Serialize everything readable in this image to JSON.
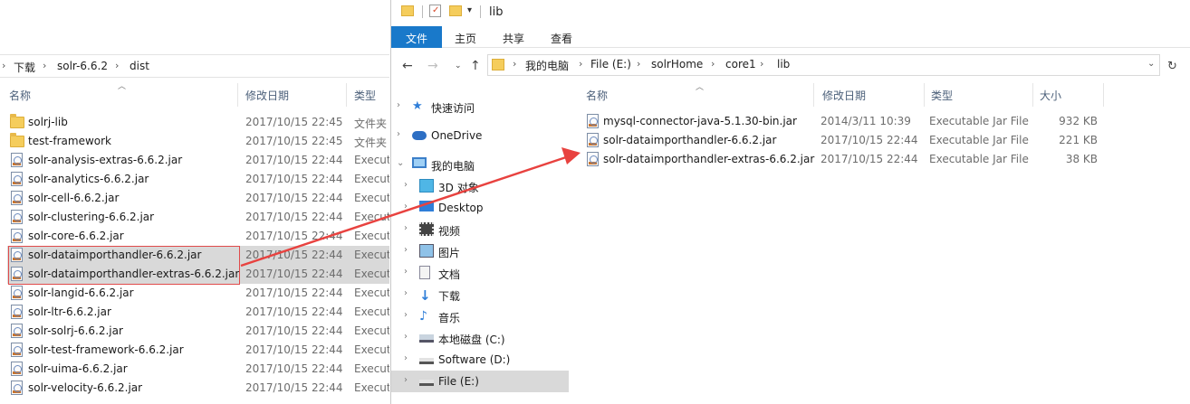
{
  "left_window": {
    "breadcrumb": [
      "下载",
      "solr-6.6.2",
      "dist"
    ],
    "columns": {
      "name": "名称",
      "date": "修改日期",
      "type": "类型"
    },
    "files": [
      {
        "name": "solrj-lib",
        "date": "2017/10/15 22:45",
        "type": "文件夹",
        "icon": "folder-icon"
      },
      {
        "name": "test-framework",
        "date": "2017/10/15 22:45",
        "type": "文件夹",
        "icon": "folder-icon"
      },
      {
        "name": "solr-analysis-extras-6.6.2.jar",
        "date": "2017/10/15 22:44",
        "type": "Executa",
        "icon": "jar-icon"
      },
      {
        "name": "solr-analytics-6.6.2.jar",
        "date": "2017/10/15 22:44",
        "type": "Executa",
        "icon": "jar-icon"
      },
      {
        "name": "solr-cell-6.6.2.jar",
        "date": "2017/10/15 22:44",
        "type": "Executa",
        "icon": "jar-icon"
      },
      {
        "name": "solr-clustering-6.6.2.jar",
        "date": "2017/10/15 22:44",
        "type": "Executa",
        "icon": "jar-icon"
      },
      {
        "name": "solr-core-6.6.2.jar",
        "date": "2017/10/15 22:44",
        "type": "Executa",
        "icon": "jar-icon"
      },
      {
        "name": "solr-dataimporthandler-6.6.2.jar",
        "date": "2017/10/15 22:44",
        "type": "Executa",
        "icon": "jar-icon",
        "selected": true
      },
      {
        "name": "solr-dataimporthandler-extras-6.6.2.jar",
        "date": "2017/10/15 22:44",
        "type": "Executa",
        "icon": "jar-icon",
        "selected": true
      },
      {
        "name": "solr-langid-6.6.2.jar",
        "date": "2017/10/15 22:44",
        "type": "Executa",
        "icon": "jar-icon"
      },
      {
        "name": "solr-ltr-6.6.2.jar",
        "date": "2017/10/15 22:44",
        "type": "Executa",
        "icon": "jar-icon"
      },
      {
        "name": "solr-solrj-6.6.2.jar",
        "date": "2017/10/15 22:44",
        "type": "Executa",
        "icon": "jar-icon"
      },
      {
        "name": "solr-test-framework-6.6.2.jar",
        "date": "2017/10/15 22:44",
        "type": "Executa",
        "icon": "jar-icon"
      },
      {
        "name": "solr-uima-6.6.2.jar",
        "date": "2017/10/15 22:44",
        "type": "Executa",
        "icon": "jar-icon"
      },
      {
        "name": "solr-velocity-6.6.2.jar",
        "date": "2017/10/15 22:44",
        "type": "Executa",
        "icon": "jar-icon"
      }
    ]
  },
  "right_window": {
    "title": "lib",
    "ribbon_tabs": [
      "文件",
      "主页",
      "共享",
      "查看"
    ],
    "breadcrumb": [
      "我的电脑",
      "File (E:)",
      "solrHome",
      "core1",
      "lib"
    ],
    "columns": {
      "name": "名称",
      "date": "修改日期",
      "type": "类型",
      "size": "大小"
    },
    "nav": [
      {
        "label": "快速访问",
        "icon": "star-icon"
      },
      {
        "label": "OneDrive",
        "icon": "cloud-icon"
      },
      {
        "label": "我的电脑",
        "icon": "computer-icon"
      },
      {
        "label": "3D 对象",
        "icon": "cube-icon"
      },
      {
        "label": "Desktop",
        "icon": "desktop-icon"
      },
      {
        "label": "视频",
        "icon": "video-icon"
      },
      {
        "label": "图片",
        "icon": "picture-icon"
      },
      {
        "label": "文档",
        "icon": "document-icon"
      },
      {
        "label": "下载",
        "icon": "download-icon"
      },
      {
        "label": "音乐",
        "icon": "music-icon"
      },
      {
        "label": "本地磁盘 (C:)",
        "icon": "drive-c-icon"
      },
      {
        "label": "Software (D:)",
        "icon": "drive-icon"
      },
      {
        "label": "File (E:)",
        "icon": "drive-icon",
        "selected": true
      }
    ],
    "files": [
      {
        "name": "mysql-connector-java-5.1.30-bin.jar",
        "date": "2014/3/11 10:39",
        "type": "Executable Jar File",
        "size": "932 KB"
      },
      {
        "name": "solr-dataimporthandler-6.6.2.jar",
        "date": "2017/10/15 22:44",
        "type": "Executable Jar File",
        "size": "221 KB"
      },
      {
        "name": "solr-dataimporthandler-extras-6.6.2.jar",
        "date": "2017/10/15 22:44",
        "type": "Executable Jar File",
        "size": "38 KB"
      }
    ]
  },
  "colors": {
    "accent": "#1979ca",
    "selection": "#d9d9d9",
    "annotation": "#e8423f"
  }
}
